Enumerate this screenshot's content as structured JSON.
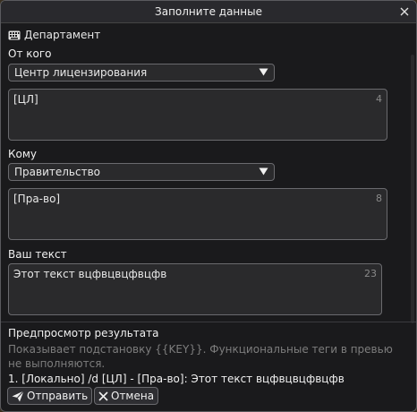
{
  "window": {
    "title": "Заполните данные"
  },
  "section": {
    "title": "Департамент"
  },
  "from": {
    "label": "От кого",
    "selected": "Центр лицензирования",
    "tag_text": "[ЦЛ]",
    "tag_count": "4"
  },
  "to": {
    "label": "Кому",
    "selected": "Правительство",
    "tag_text": "[Пра-во]",
    "tag_count": "8"
  },
  "message": {
    "label": "Ваш текст",
    "text": "Этот текст вцфвцвцфвцфв",
    "count": "23"
  },
  "preview": {
    "title": "Предпросмотр результата",
    "hint": "Показывает подстановку {{KEY}}. Функциональные теги в превью не выполняются.",
    "result": "1. [Локально] /d [ЦЛ] - [Пра-во]: Этот текст вцфвцвцфвцфв"
  },
  "buttons": {
    "send": "Отправить",
    "cancel": "Отмена"
  }
}
